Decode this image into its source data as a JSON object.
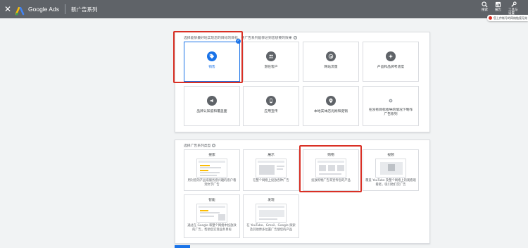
{
  "topbar": {
    "close": "✕",
    "brand": "Google Ads",
    "title": "新广告系列",
    "tools": [
      {
        "icon": "search-icon",
        "label": "搜索"
      },
      {
        "icon": "report-icon",
        "label": "报告"
      },
      {
        "icon": "tools-icon",
        "label": "工具与设置"
      }
    ]
  },
  "notice": {
    "text": "您上传帐号的网络链接无效"
  },
  "goals": {
    "heading": "选择能够最好地实现您的目标的目标，使广告系列能够达到您想要的效果",
    "items": [
      {
        "label": "销售",
        "icon": "tag-icon",
        "selected": true
      },
      {
        "label": "潜在客户",
        "icon": "people-icon",
        "selected": false
      },
      {
        "label": "网站流量",
        "icon": "cursor-icon",
        "selected": false
      },
      {
        "label": "产品和品牌考虑度",
        "icon": "sparkle-icon",
        "selected": false
      },
      {
        "label": "品牌认知度和覆盖面",
        "icon": "megaphone-icon",
        "selected": false
      },
      {
        "label": "应用宣传",
        "icon": "phone-icon",
        "selected": false
      },
      {
        "label": "本地实体店光顾和促销",
        "icon": "pin-icon",
        "selected": false
      },
      {
        "label": "在没有目标指导的情况下制作广告系列",
        "icon": "gear-icon",
        "selected": false
      }
    ]
  },
  "types": {
    "heading": "选择广告系列类型",
    "items": [
      {
        "name": "搜索",
        "desc": "用对您的产品或服务感兴趣的客户看到文字广告"
      },
      {
        "name": "展示",
        "desc": "在整个网络上投放各种广告"
      },
      {
        "name": "购物",
        "desc": "投放购物广告来宣传您的产品"
      },
      {
        "name": "视频",
        "desc": "覆盖 YouTube 及整个网络上的观看观看者，吸引他们完广告"
      },
      {
        "name": "智能",
        "desc": "通过在 Google 和整个网络中投放效的广告，帮助您实现业务目标"
      },
      {
        "name": "发现",
        "desc": "在 YouTube、Gmail、Google 探索及其他更多位置广告使您的产品"
      }
    ]
  },
  "colors": {
    "accent": "#1a73e8",
    "highlight": "#d93025",
    "topbar": "#5f6368"
  }
}
